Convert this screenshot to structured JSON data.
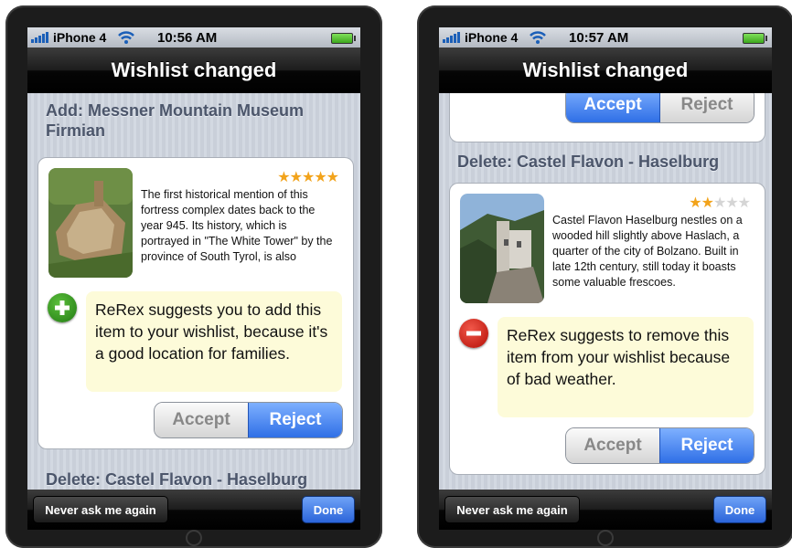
{
  "left_phone": {
    "status": {
      "carrier": "iPhone 4",
      "time": "10:56 AM"
    },
    "nav_title": "Wishlist changed",
    "add_section": {
      "header": "Add:  Messner Mountain Museum Firmian",
      "rating": 5,
      "description": "The first historical mention of this fortress complex dates back to the year 945. Its history, which is portrayed in \"The White Tower\" by the province of South Tyrol, is also presented by Reinhold Mes",
      "suggestion": "ReRex suggests you to add this item to your wishlist, because it's a good location for families.",
      "accept_label": "Accept",
      "reject_label": "Reject",
      "selected": "Reject"
    },
    "next_header": "Delete:  Castel Flavon - Haselburg",
    "toolbar": {
      "never_label": "Never ask me again",
      "done_label": "Done"
    }
  },
  "right_phone": {
    "status": {
      "carrier": "iPhone 4",
      "time": "10:57 AM"
    },
    "nav_title": "Wishlist changed",
    "prev_controls": {
      "accept_label": "Accept",
      "reject_label": "Reject",
      "selected": "Accept"
    },
    "delete_section": {
      "header": "Delete:  Castel Flavon - Haselburg",
      "rating": 2,
      "description": "Castel Flavon Haselburg nestles on a wooded hill slightly above Haslach, a quarter of the city of Bolzano. Built in late 12th century, still today it boasts some valuable frescoes.",
      "suggestion": "ReRex suggests to remove this item from your wishlist because of bad weather.",
      "accept_label": "Accept",
      "reject_label": "Reject",
      "selected": "Reject"
    },
    "toolbar": {
      "never_label": "Never ask me again",
      "done_label": "Done"
    }
  },
  "colors": {
    "accent_blue": "#2f6fe6",
    "add_green": "#2a8a17",
    "remove_red": "#c8140a",
    "star_gold": "#f2a31b",
    "header_text": "#4c566b",
    "suggestion_bg": "#fdfbd9"
  }
}
